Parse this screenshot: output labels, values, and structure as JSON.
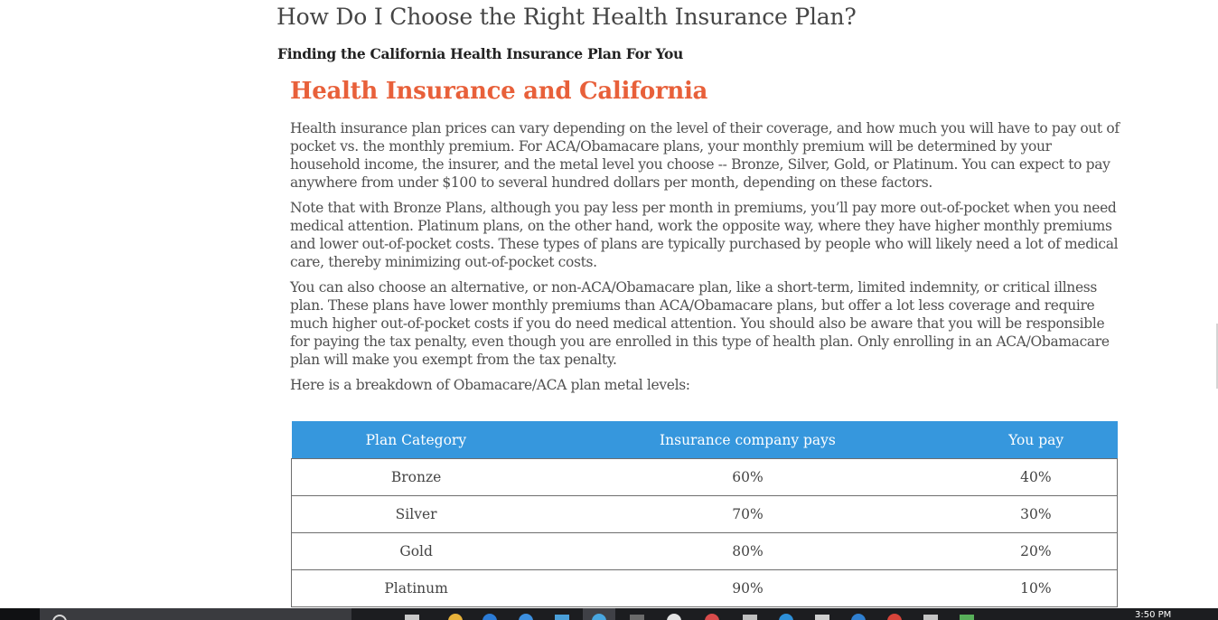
{
  "article": {
    "title": "How Do I Choose the Right Health Insurance Plan?",
    "subtitle": "Finding the California Health Insurance Plan For You",
    "section_heading": "Health Insurance and California",
    "paragraphs": [
      "Health insurance plan prices can vary depending on the level of their coverage, and how much you will have to pay out of pocket vs. the monthly premium. For ACA/Obamacare plans, your monthly premium will be determined by your household income, the insurer, and the metal level you choose -- Bronze, Silver, Gold, or Platinum. You can expect to pay anywhere from under $100 to several hundred dollars per month, depending on these factors.",
      "Note that with Bronze Plans, although you pay less per month in premiums, you’ll pay more out-of-pocket when you need medical attention. Platinum plans, on the other hand, work the opposite way, where they have higher monthly premiums and lower out-of-pocket costs. These types of plans are typically purchased by people who will likely need a lot of medical care, thereby minimizing out-of-pocket costs.",
      "You can also choose an alternative, or non-ACA/Obamacare plan, like a short-term, limited indemnity, or critical illness plan. These plans have lower monthly premiums than ACA/Obamacare plans, but offer a lot less coverage and require much higher out-of-pocket costs if you do need medical attention. You should also be aware that you will be responsible for paying the tax penalty, even though you are enrolled in this type of health plan. Only enrolling in an ACA/Obamacare plan will make you exempt from the tax penalty.",
      "Here is a breakdown of Obamacare/ACA plan metal levels:"
    ]
  },
  "plan_table": {
    "headers": [
      "Plan Category",
      "Insurance company pays",
      "You pay"
    ],
    "rows": [
      [
        "Bronze",
        "60%",
        "40%"
      ],
      [
        "Silver",
        "70%",
        "30%"
      ],
      [
        "Gold",
        "80%",
        "20%"
      ],
      [
        "Platinum",
        "90%",
        "10%"
      ]
    ]
  },
  "colors": {
    "section_heading": "#e8603a",
    "table_header_bg": "#3697dd",
    "taskbar_bg": "#1c1d20"
  },
  "taskbar": {
    "clock": "3:50 PM",
    "icons": [
      "windows-start-icon",
      "search-icon",
      "file-explorer-icon",
      "chrome-icon",
      "edge-icon",
      "store-icon",
      "mail-icon",
      "settings-icon"
    ]
  }
}
